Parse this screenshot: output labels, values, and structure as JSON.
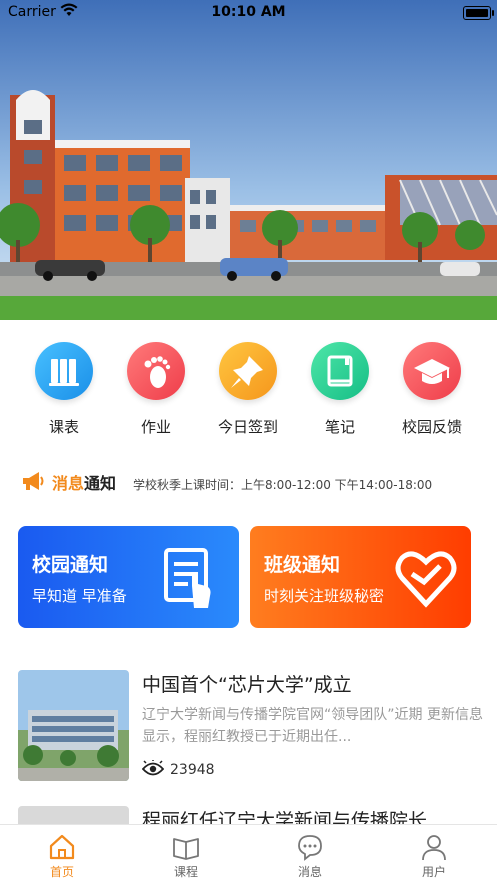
{
  "status": {
    "carrier": "Carrier",
    "time": "10:10 AM"
  },
  "quick_actions": [
    {
      "label": "课表",
      "color": "#2aa8f2",
      "icon": "schedule-icon"
    },
    {
      "label": "作业",
      "color": "#f25b5b",
      "icon": "footprint-icon"
    },
    {
      "label": "今日签到",
      "color": "#f9a825",
      "icon": "pin-icon"
    },
    {
      "label": "笔记",
      "color": "#26d19a",
      "icon": "notebook-icon"
    },
    {
      "label": "校园反馈",
      "color": "#f25b5b",
      "icon": "graduation-cap-icon"
    }
  ],
  "notice": {
    "label_part1": "消息",
    "label_part2": "通知",
    "text": "学校秋季上课时间：上午8:00-12:00 下午14:00-18:00"
  },
  "cards": [
    {
      "title": "校园通知",
      "subtitle": "早知道 早准备",
      "icon": "clipboard-hand-icon"
    },
    {
      "title": "班级通知",
      "subtitle": "时刻关注班级秘密",
      "icon": "heart-hand-icon"
    }
  ],
  "news": [
    {
      "title": "中国首个“芯片大学”成立",
      "desc": "辽宁大学新闻与传播学院官网“领导团队”近期 更新信息显示，程丽红教授已于近期出任...",
      "views": "23948"
    },
    {
      "title": "程丽红任辽宁大学新闻与传播院长"
    }
  ],
  "tabs": [
    {
      "label": "首页",
      "icon": "home-icon",
      "active": true
    },
    {
      "label": "课程",
      "icon": "book-icon",
      "active": false
    },
    {
      "label": "消息",
      "icon": "message-icon",
      "active": false
    },
    {
      "label": "用户",
      "icon": "user-icon",
      "active": false
    }
  ],
  "colors": {
    "accent": "#f28a1d",
    "blue_card": "#1a5af0",
    "orange_card": "#ff5a12"
  }
}
